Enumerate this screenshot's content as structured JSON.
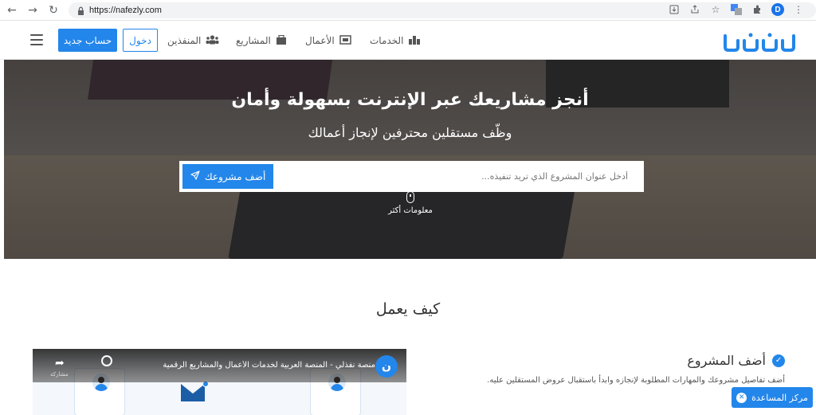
{
  "browser": {
    "url": "https://nafezly.com",
    "avatar_letter": "D"
  },
  "header": {
    "logo_alt": "نفذلي",
    "menu": [
      {
        "label": "الخدمات",
        "icon": "services-icon"
      },
      {
        "label": "الأعمال",
        "icon": "portfolio-icon"
      },
      {
        "label": "المشاريع",
        "icon": "briefcase-icon"
      },
      {
        "label": "المنفذين",
        "icon": "users-icon"
      }
    ],
    "login_label": "دخول",
    "signup_label": "حساب جديد"
  },
  "hero": {
    "title": "أنجز مشاريعك عبر الإنترنت بسهولة وأمان",
    "subtitle": "وظّف مستقلين محترفين لإنجاز أعمالك",
    "search_placeholder": "أدخل عنوان المشروع الذي تريد تنفيذه...",
    "add_project_label": "أضف مشروعك",
    "more_info_label": "معلومات أكثر"
  },
  "how": {
    "title": "كيف يعمل"
  },
  "video": {
    "title": "منصة نفذلي - المنصة العربية لخدمات الأعمال والمشاريع الرقمية",
    "share_label": "مشاركة"
  },
  "step": {
    "title": "أضف المشروع",
    "description": "أضف تفاصيل مشروعك والمهارات المطلوبة لإنجازه وابدأ باستقبال عروض المستقلين عليه."
  },
  "help": {
    "label": "مركز المساعدة"
  },
  "colors": {
    "accent": "#2386ea"
  }
}
